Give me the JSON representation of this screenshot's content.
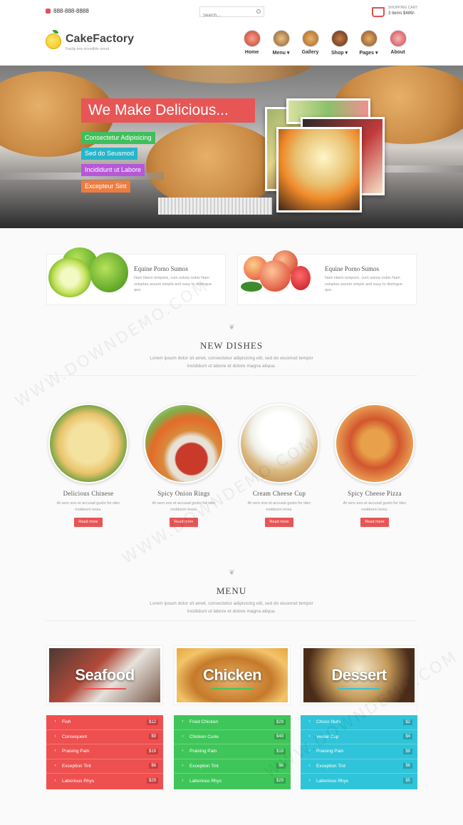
{
  "topbar": {
    "phone": "888-888-8888",
    "search_placeholder": "Search...",
    "cart_title": "SHOPPING CART",
    "cart_summary": "3 items $489/-"
  },
  "header": {
    "logo_title": "CakeFactory",
    "logo_subtitle": "Facilip tem incredible ormut",
    "nav": [
      {
        "label": "Home",
        "color": "#e0473a"
      },
      {
        "label": "Menu ▾",
        "color": "#a0662e"
      },
      {
        "label": "Gallery",
        "color": "#b97836"
      },
      {
        "label": "Shop ▾",
        "color": "#8a4b2a"
      },
      {
        "label": "Pages ▾",
        "color": "#c07a3a"
      },
      {
        "label": "About",
        "color": "#d64e5a"
      }
    ]
  },
  "hero": {
    "title": "We Make Delicious...",
    "tags": [
      {
        "text": "Consectetur Adipisicing",
        "color": "#3fbf5b"
      },
      {
        "text": "Sed do Seusmod",
        "color": "#27b5c9"
      },
      {
        "text": "Incididunt ut Labore",
        "color": "#b658d8"
      },
      {
        "text": "Excepteur Sint",
        "color": "#ee7c3f"
      }
    ]
  },
  "features": [
    {
      "title": "Equine Porno Sumos",
      "text": "Nam libero tempore, cum soluta nobis Nam voluptas assum simple and easy to distingue quo."
    },
    {
      "title": "Equine Porno Sumos",
      "text": "Nam libero tempore, cum soluta nobis Nam voluptas assum simple and easy to distingue quo."
    }
  ],
  "new_dishes": {
    "title": "NEW DISHES",
    "text": "Lorem ipsum dolor sit amet, consectetur adipisicing elit, sed do eiusmod tempor incididunt ut labore et dolore magna aliqua.",
    "items": [
      {
        "name": "Delicious Chinese",
        "text": "At vero eos et accusal gusto for idec moldoom lores.",
        "button": "Read more"
      },
      {
        "name": "Spicy Onion Rings",
        "text": "At vero eos et accusal gusto for idec moldoom lores.",
        "button": "Read more"
      },
      {
        "name": "Cream Cheese Cup",
        "text": "At vero eos et accusal gusto for idec moldoom lores.",
        "button": "Read more"
      },
      {
        "name": "Spicy Cheese Pizza",
        "text": "At vero eos et accusal gusto for idec moldoom lores.",
        "button": "Read more"
      }
    ]
  },
  "menu_section": {
    "title": "MENU",
    "text": "Lorem ipsum dolor sit amet, consectetur adipisicing elit, sed do eiusmod tempor incididunt ut labore et dolore magna aliqua.",
    "categories": [
      {
        "label": "Seafood",
        "color": "#ee4f4f",
        "items": [
          {
            "name": "Fish",
            "price": "$12"
          },
          {
            "name": "Consequent",
            "price": "$9"
          },
          {
            "name": "Praising Pain",
            "price": "$19"
          },
          {
            "name": "Exception Tint",
            "price": "$6"
          },
          {
            "name": "Laborious Rhys",
            "price": "$29"
          }
        ]
      },
      {
        "label": "Chicken",
        "color": "#3fc65a",
        "items": [
          {
            "name": "Fried Chicken",
            "price": "$29"
          },
          {
            "name": "Chicken Curie",
            "price": "$49"
          },
          {
            "name": "Praising Pain",
            "price": "$19"
          },
          {
            "name": "Exception Tint",
            "price": "$6"
          },
          {
            "name": "Laborious Rhys",
            "price": "$29"
          }
        ]
      },
      {
        "label": "Dessert",
        "color": "#2fc4d9",
        "items": [
          {
            "name": "Choco Nuts",
            "price": "$2"
          },
          {
            "name": "Venial Cup",
            "price": "$4"
          },
          {
            "name": "Praising Pain",
            "price": "$9"
          },
          {
            "name": "Exception Tint",
            "price": "$6"
          },
          {
            "name": "Laborious Rhys",
            "price": "$5"
          }
        ]
      }
    ]
  },
  "watermark": "WWW.DOWNDEMO.COM"
}
